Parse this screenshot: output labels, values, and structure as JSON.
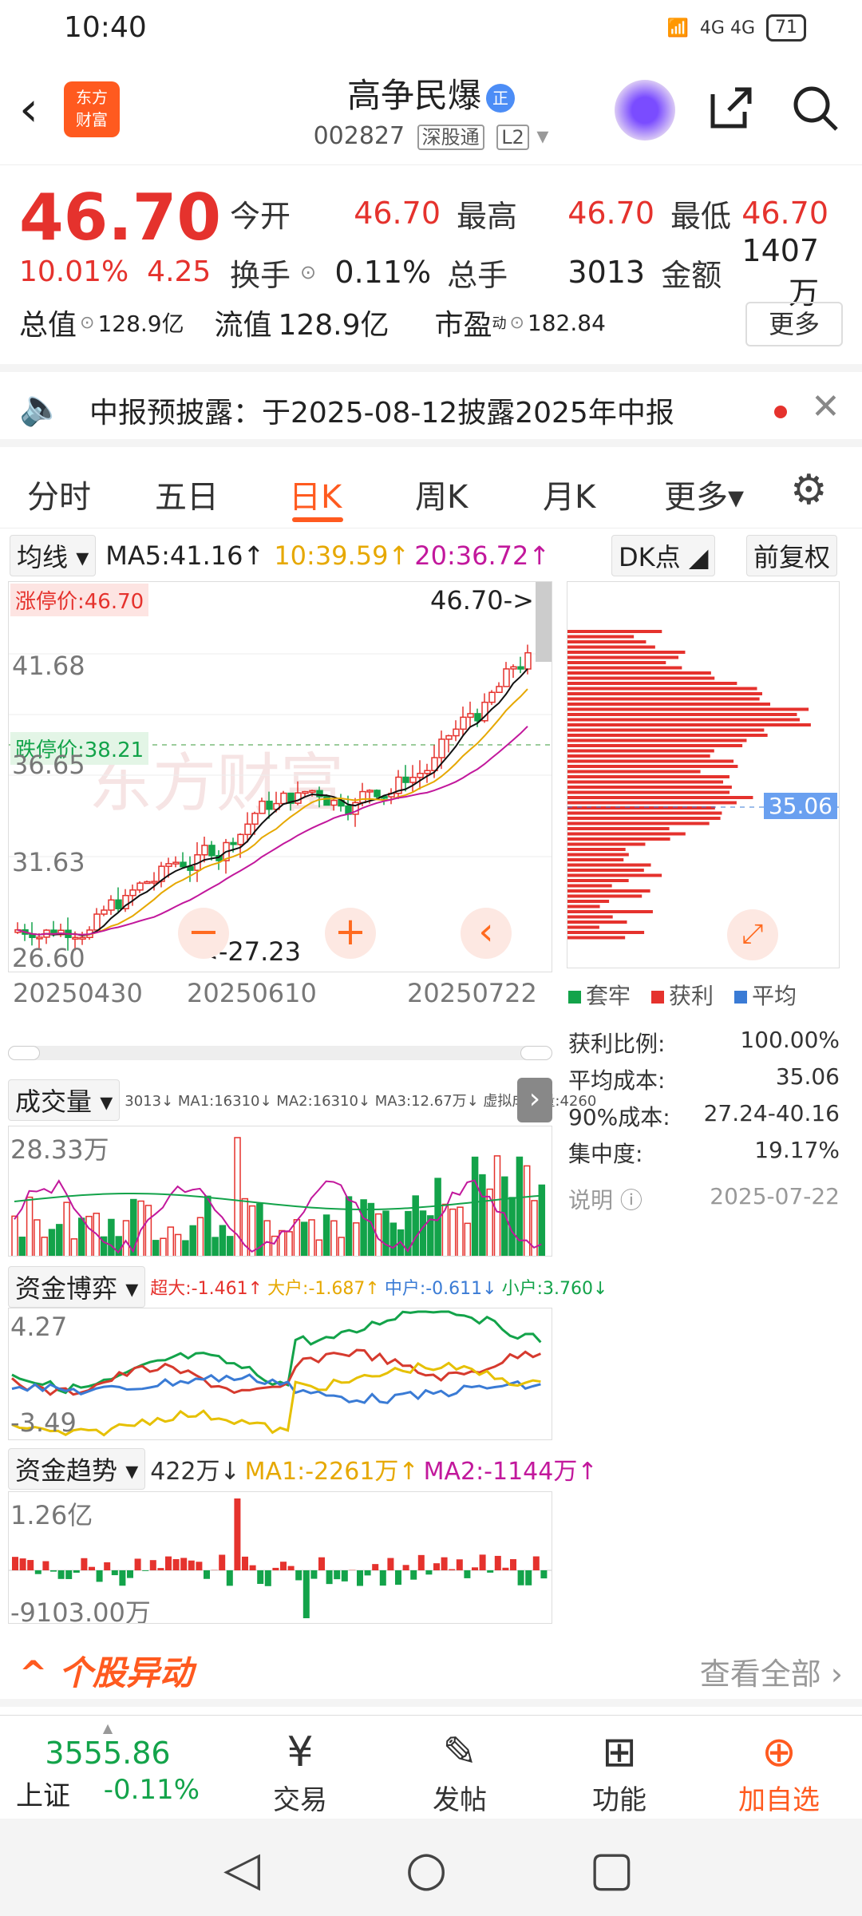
{
  "status": {
    "time": "10:40",
    "battery": "71",
    "signal": "4G 4G"
  },
  "header": {
    "logo_line1": "东方",
    "logo_line2": "财富",
    "name": "高争民爆",
    "badge": "正",
    "code": "002827",
    "tag1": "深股通",
    "tag2": "L2"
  },
  "quote": {
    "price": "46.70",
    "pct": "10.01%",
    "chg": "4.25",
    "open_label": "今开",
    "open": "46.70",
    "high_label": "最高",
    "high": "46.70",
    "low_label": "最低",
    "low": "46.70",
    "turnover_label": "换手",
    "turnover": "0.11%",
    "vol_label": "总手",
    "vol": "3013",
    "amount_label": "金额",
    "amount": "1407万",
    "mktcap_label": "总值",
    "mktcap": "128.9亿",
    "float_label": "流值",
    "float": "128.9亿",
    "pe_label": "市盈",
    "pe_sup": "动",
    "pe": "182.84",
    "more": "更多"
  },
  "notice": {
    "text": "中报预披露：于2025-08-12披露2025年中报"
  },
  "tabs": [
    {
      "label": "分时"
    },
    {
      "label": "五日"
    },
    {
      "label": "日K"
    },
    {
      "label": "周K"
    },
    {
      "label": "月K"
    },
    {
      "label": "更多▾"
    }
  ],
  "mabar": {
    "type": "均线",
    "ma5": "MA5:41.16↑",
    "ma10": "10:39.59↑",
    "ma20": "20:36.72↑",
    "dk": "DK点",
    "adj": "前复权"
  },
  "kline": {
    "limit_up": "涨停价:46.70",
    "limit_down": "跌停价:38.21",
    "y1": "41.68",
    "y2": "36.65",
    "y3": "31.63",
    "y4": "26.60",
    "y0": "46.70",
    "last_arrow": "46.70->",
    "low_mark": "<-27.23",
    "d1": "20250430",
    "d2": "20250610",
    "d3": "20250722",
    "watermark": "东方财富"
  },
  "chips": {
    "avg": "35.06",
    "legend": [
      "套牢",
      "获利",
      "平均"
    ],
    "legend_colors": [
      "#13a34a",
      "#e5322d",
      "#3a7bd5"
    ],
    "rows": [
      {
        "k": "获利比例:",
        "v": "100.00%"
      },
      {
        "k": "平均成本:",
        "v": "35.06"
      },
      {
        "k": "90%成本:",
        "v": "27.24-40.16"
      },
      {
        "k": "集中度:",
        "v": "19.17%"
      },
      {
        "k": "说明",
        "v": "2025-07-22"
      }
    ]
  },
  "volume": {
    "label": "成交量",
    "vals": "3013↓ MA1:16310↓ MA2:16310↓ MA3:12.67万↓ 虚拟成交量:4260",
    "ymax": "28.33万"
  },
  "fund_game": {
    "label": "资金博弈",
    "super": "超大:-1.461↑",
    "big": "大户:-1.687↑",
    "mid": "中户:-0.611↓",
    "small": "小户:3.760↓",
    "ymax": "4.27",
    "ymin": "-3.49"
  },
  "fund_trend": {
    "label": "资金趋势",
    "v": "422万↓",
    "ma1": "MA1:-2261万↑",
    "ma2": "MA2:-1144万↑",
    "ymax": "1.26亿",
    "ymin": "-9103.00万"
  },
  "movement": {
    "title": "个股异动",
    "more": "查看全部"
  },
  "bottom": {
    "index_value": "3555.86",
    "index_name": "上证",
    "index_pct": "-0.11%",
    "items": [
      "交易",
      "发帖",
      "功能",
      "加自选"
    ]
  }
}
